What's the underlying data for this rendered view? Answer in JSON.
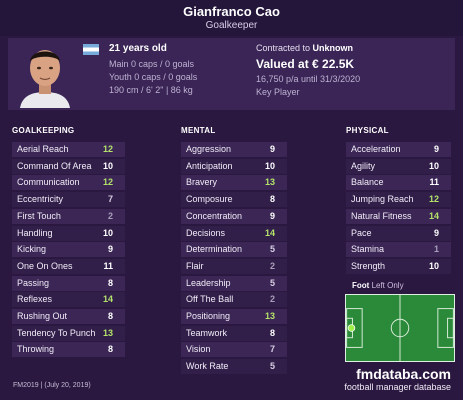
{
  "header": {
    "name": "Gianfranco Cao",
    "role": "Goalkeeper"
  },
  "profile": {
    "age": "21 years old",
    "main_caps": "Main 0 caps / 0 goals",
    "youth_caps": "Youth 0 caps / 0 goals",
    "physique": "190 cm / 6' 2\" | 86 kg",
    "contract_prefix": "Contracted to",
    "contract_club": "Unknown",
    "value": "Valued at € 22.5K",
    "wage": "16,750 p/a until 31/3/2020",
    "status": "Key Player",
    "nation_flag": "argentina-flag"
  },
  "goalkeeping": {
    "title": "GOALKEEPING",
    "attrs": [
      {
        "label": "Aerial Reach",
        "value": "12"
      },
      {
        "label": "Command Of Area",
        "value": "10"
      },
      {
        "label": "Communication",
        "value": "12"
      },
      {
        "label": "Eccentricity",
        "value": "7"
      },
      {
        "label": "First Touch",
        "value": "2"
      },
      {
        "label": "Handling",
        "value": "10"
      },
      {
        "label": "Kicking",
        "value": "9"
      },
      {
        "label": "One On Ones",
        "value": "11"
      },
      {
        "label": "Passing",
        "value": "8"
      },
      {
        "label": "Reflexes",
        "value": "14"
      },
      {
        "label": "Rushing Out",
        "value": "8"
      },
      {
        "label": "Tendency To Punch",
        "value": "13"
      },
      {
        "label": "Throwing",
        "value": "8"
      }
    ]
  },
  "mental": {
    "title": "MENTAL",
    "attrs": [
      {
        "label": "Aggression",
        "value": "9"
      },
      {
        "label": "Anticipation",
        "value": "10"
      },
      {
        "label": "Bravery",
        "value": "13"
      },
      {
        "label": "Composure",
        "value": "8"
      },
      {
        "label": "Concentration",
        "value": "9"
      },
      {
        "label": "Decisions",
        "value": "14"
      },
      {
        "label": "Determination",
        "value": "5"
      },
      {
        "label": "Flair",
        "value": "2"
      },
      {
        "label": "Leadership",
        "value": "5"
      },
      {
        "label": "Off The Ball",
        "value": "2"
      },
      {
        "label": "Positioning",
        "value": "13"
      },
      {
        "label": "Teamwork",
        "value": "8"
      },
      {
        "label": "Vision",
        "value": "7"
      },
      {
        "label": "Work Rate",
        "value": "5"
      }
    ]
  },
  "physical": {
    "title": "PHYSICAL",
    "attrs": [
      {
        "label": "Acceleration",
        "value": "9"
      },
      {
        "label": "Agility",
        "value": "10"
      },
      {
        "label": "Balance",
        "value": "11"
      },
      {
        "label": "Jumping Reach",
        "value": "12"
      },
      {
        "label": "Natural Fitness",
        "value": "14"
      },
      {
        "label": "Pace",
        "value": "9"
      },
      {
        "label": "Stamina",
        "value": "1"
      },
      {
        "label": "Strength",
        "value": "10"
      }
    ]
  },
  "foot": {
    "label": "Foot",
    "value": "Left Only"
  },
  "footer": {
    "version": "FM2019 | (July 20, 2019)",
    "brand": "fmdataba.com",
    "brand_sub": "football manager database"
  }
}
